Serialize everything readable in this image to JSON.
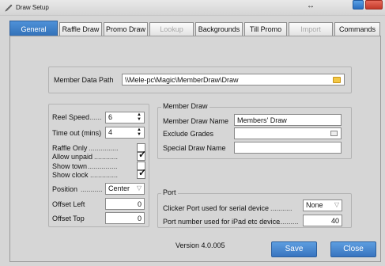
{
  "window": {
    "title": "Draw Setup",
    "resize_glyph": "↔",
    "accent_color": "#3f80c9"
  },
  "tabs": [
    {
      "label": "General",
      "active": true,
      "disabled": false
    },
    {
      "label": "Raffle Draw",
      "active": false,
      "disabled": false
    },
    {
      "label": "Promo Draw",
      "active": false,
      "disabled": false
    },
    {
      "label": "Lookup",
      "active": false,
      "disabled": true
    },
    {
      "label": "Backgrounds",
      "active": false,
      "disabled": false
    },
    {
      "label": "Till Promo",
      "active": false,
      "disabled": false
    },
    {
      "label": "Import",
      "active": false,
      "disabled": true
    },
    {
      "label": "Commands",
      "active": false,
      "disabled": false
    }
  ],
  "member_data_path": {
    "label": "Member Data Path",
    "value": "\\\\Mele-pc\\Magic\\MemberDraw\\Draw",
    "icon": "folder-icon"
  },
  "left_settings": {
    "reel_speed": {
      "label": "Reel Speed",
      "dots": ".......",
      "value": "6"
    },
    "time_out": {
      "label": "Time out (mins)",
      "value": "4"
    },
    "raffle_only": {
      "label": "Raffle Only",
      "dots": "...............",
      "checked": false
    },
    "allow_unpaid": {
      "label": "Allow unpaid",
      "dots": "............",
      "checked": true
    },
    "show_town": {
      "label": "Show town",
      "dots": "...............",
      "checked": false
    },
    "show_clock": {
      "label": "Show clock",
      "dots": "..............",
      "checked": true
    },
    "position": {
      "label": "Position",
      "dots": "...........",
      "value": "Center"
    },
    "offset_left": {
      "label": "Offset Left",
      "value": "0"
    },
    "offset_top": {
      "label": "Offset Top",
      "value": "0"
    }
  },
  "member_draw": {
    "title": "Member Draw",
    "member_draw_name": {
      "label": "Member Draw Name",
      "value": "Members' Draw"
    },
    "exclude_grades": {
      "label": "Exclude Grades",
      "value": ""
    },
    "special_draw_name": {
      "label": "Special Draw Name",
      "value": ""
    }
  },
  "port": {
    "title": "Port",
    "clicker_port": {
      "label": "Clicker Port used for serial device",
      "dots": "...........",
      "value": "None"
    },
    "ipad_port": {
      "label": "Port number used for iPad etc device",
      "dots": "...........",
      "value": "40"
    }
  },
  "footer": {
    "version": "Version 4.0.005",
    "save_label": "Save",
    "close_label": "Close"
  }
}
